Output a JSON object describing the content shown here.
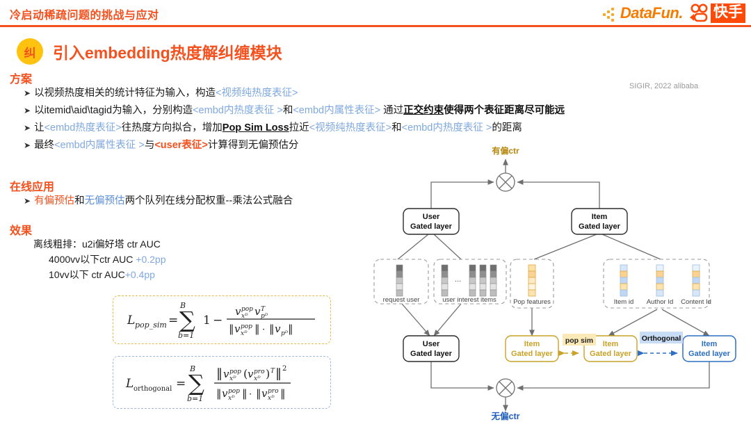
{
  "header": {
    "title": "冷启动稀疏问题的挑战与应对",
    "logo_datafun": "DataFun.",
    "logo_kuaishou": "快手",
    "accent": "#F4511E"
  },
  "headline": {
    "badge": "纠",
    "text": "引入embedding热度解纠缠模块"
  },
  "sections": {
    "plan_title": "方案",
    "online_title": "在线应用",
    "effect_title": "效果"
  },
  "plan_bullets": [
    {
      "parts": [
        {
          "t": "以视频热度相关的统计特征为输入，构造",
          "s": "plain"
        },
        {
          "t": "<视频纯热度表征>",
          "s": "blue"
        }
      ]
    },
    {
      "parts": [
        {
          "t": "以itemid\\aid\\tagid为输入，分别构造",
          "s": "plain"
        },
        {
          "t": "<embd内热度表征 >",
          "s": "blue"
        },
        {
          "t": "和",
          "s": "plain"
        },
        {
          "t": "<embd内属性表征>",
          "s": "blue"
        },
        {
          "t": " 通过",
          "s": "plain"
        },
        {
          "t": "正交约束",
          "s": "bold-u"
        },
        {
          "t": "使得两个表征距离尽可能远",
          "s": "bold"
        }
      ]
    },
    {
      "parts": [
        {
          "t": "让",
          "s": "plain"
        },
        {
          "t": "<embd热度表征>",
          "s": "blue"
        },
        {
          "t": "往热度方向拟合，增加",
          "s": "plain"
        },
        {
          "t": "Pop Sim Loss",
          "s": "bold-u"
        },
        {
          "t": "拉近",
          "s": "plain"
        },
        {
          "t": "<视频纯热度表征>",
          "s": "blue"
        },
        {
          "t": "和",
          "s": "plain"
        },
        {
          "t": "<embd内热度表征 >",
          "s": "blue"
        },
        {
          "t": "的距离",
          "s": "plain"
        }
      ]
    },
    {
      "parts": [
        {
          "t": "最终",
          "s": "plain"
        },
        {
          "t": "<embd内属性表征 >",
          "s": "blue"
        },
        {
          "t": "与",
          "s": "plain"
        },
        {
          "t": "<user表征>",
          "s": "orange"
        },
        {
          "t": "计算得到无偏预估分",
          "s": "plain"
        }
      ]
    }
  ],
  "online_bullets": [
    {
      "parts": [
        {
          "t": "有偏预估",
          "s": "orange-plain"
        },
        {
          "t": "和",
          "s": "plain"
        },
        {
          "t": "无偏预估",
          "s": "blue-d"
        },
        {
          "t": "两个队列在线分配权重--乘法公式融合",
          "s": "plain"
        }
      ]
    }
  ],
  "effect_lines": [
    {
      "text": "离线粗排：u2i偏好塔 ctr AUC",
      "indent": 0,
      "suffix": "",
      "suffix_color": ""
    },
    {
      "text": "4000vv以下ctr AUC ",
      "indent": 1,
      "suffix": "+0.2pp",
      "suffix_color": "#7FA8E0"
    },
    {
      "text": "10vv以下 ctr AUC",
      "indent": 1,
      "suffix": "+0.4pp",
      "suffix_color": "#7FA8E0"
    }
  ],
  "sigir_note": "SIGIR, 2022 alibaba",
  "formulas": {
    "pop_sim": {
      "name": "L_pop_sim",
      "latex": "L_{pop\\_sim} = \\sum_{b=1}^{B} 1 - \\frac{v_{x_b}^{pop} v_{p_b}^{T}}{\\|v_{x_b}^{pop}\\| \\cdot \\|v_{p_b}\\|}",
      "border_color": "#E3B94B"
    },
    "orthogonal": {
      "name": "L_orthogonal",
      "latex": "L_{orthogonal} = \\sum_{b=1}^{B} \\frac{\\|v_{x_b}^{pop} (v_{x_b}^{pro})^{T}\\|^{2}}{\\|v_{x_b}^{pop}\\| \\cdot \\|v_{x_b}^{pro}\\|}",
      "border_color": "#9FB8DC"
    }
  },
  "diagram": {
    "top_output": "有偏ctr",
    "bottom_output": "无偏ctr",
    "top_output_color": "#B8860B",
    "bottom_output_color": "#1F5FBF",
    "nodes": {
      "user_gate_top": "User\nGated layer",
      "item_gate_top": "Item\nGated layer",
      "user_gate_bottom": "User\nGated layer",
      "item_gate_pop": "Item\nGated layer",
      "item_gate_mid": "Item\nGated layer",
      "item_gate_pro": "Item\nGated layer"
    },
    "node_lines": {
      "user_l1": "User",
      "user_l2": "Gated layer",
      "item_l1": "Item",
      "item_l2": "Gated layer"
    },
    "feature_groups": [
      {
        "label": "request user",
        "bars": 1,
        "color": "gray"
      },
      {
        "label": "user interest items",
        "bars": 4,
        "color": "gray",
        "ellipsis": "..."
      },
      {
        "label": "Pop features",
        "bars": 1,
        "color": "orange"
      },
      {
        "label": "Item id",
        "bars": 1,
        "color": "blue-orange"
      },
      {
        "label": "Author Id",
        "bars": 1,
        "color": "blue-orange"
      },
      {
        "label": "Content Id",
        "bars": 1,
        "color": "blue-orange"
      }
    ],
    "edge_labels": {
      "pop_sim": "pop sim",
      "orthogonal": "Orthogonal"
    },
    "colors": {
      "gold": "#C9A227",
      "gold_fill": "#FCE9B8",
      "blue": "#2D6FC4",
      "blue_fill": "#C8DCF5",
      "gray_stroke": "#7a7a7a"
    }
  }
}
